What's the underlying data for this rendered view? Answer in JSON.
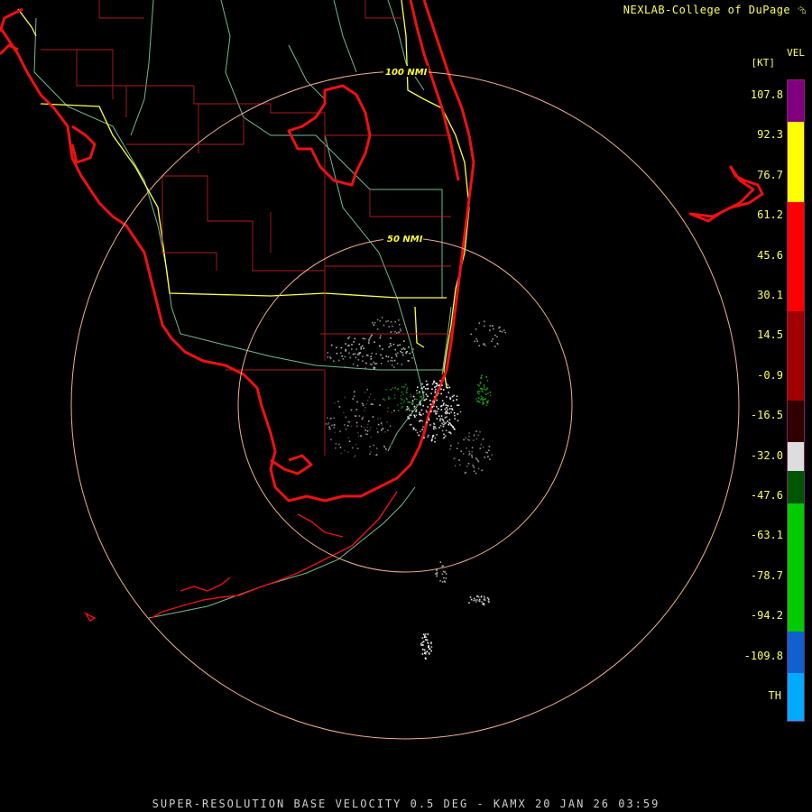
{
  "header": {
    "credit": "NEXLAB-College of DuPage",
    "credit_icon": "nexlab-logo-icon"
  },
  "footer": {
    "caption": "SUPER-RESOLUTION BASE VELOCITY 0.5 DEG - KAMX 20 JAN 26 03:59"
  },
  "map": {
    "range_rings": [
      {
        "label": "50 NMI"
      },
      {
        "label": "100 NMI"
      }
    ],
    "colors": {
      "coast": "#ee1111",
      "county": "#cc2222",
      "interstate": "#ffff44",
      "highway": "#88ddaa",
      "ring": "#f0b090"
    }
  },
  "legend": {
    "product": "VEL",
    "unit": "[KT]",
    "ticks": [
      "107.8",
      "92.3",
      "76.7",
      "61.2",
      "45.6",
      "30.1",
      "14.5",
      "-0.9",
      "-16.5",
      "-32.0",
      "-47.6",
      "-63.1",
      "-78.7",
      "-94.2",
      "-109.8",
      "TH"
    ],
    "bands": [
      {
        "color": "#800080",
        "frac": 0.065
      },
      {
        "color": "#ffff00",
        "frac": 0.125
      },
      {
        "color": "#ff0000",
        "frac": 0.17
      },
      {
        "color": "#a00000",
        "frac": 0.14
      },
      {
        "color": "#300000",
        "frac": 0.065
      },
      {
        "color": "#dddddd",
        "frac": 0.045
      },
      {
        "color": "#005500",
        "frac": 0.05
      },
      {
        "color": "#00cc00",
        "frac": 0.2
      },
      {
        "color": "#1060d0",
        "frac": 0.065
      },
      {
        "color": "#00aaff",
        "frac": 0.075
      }
    ]
  }
}
